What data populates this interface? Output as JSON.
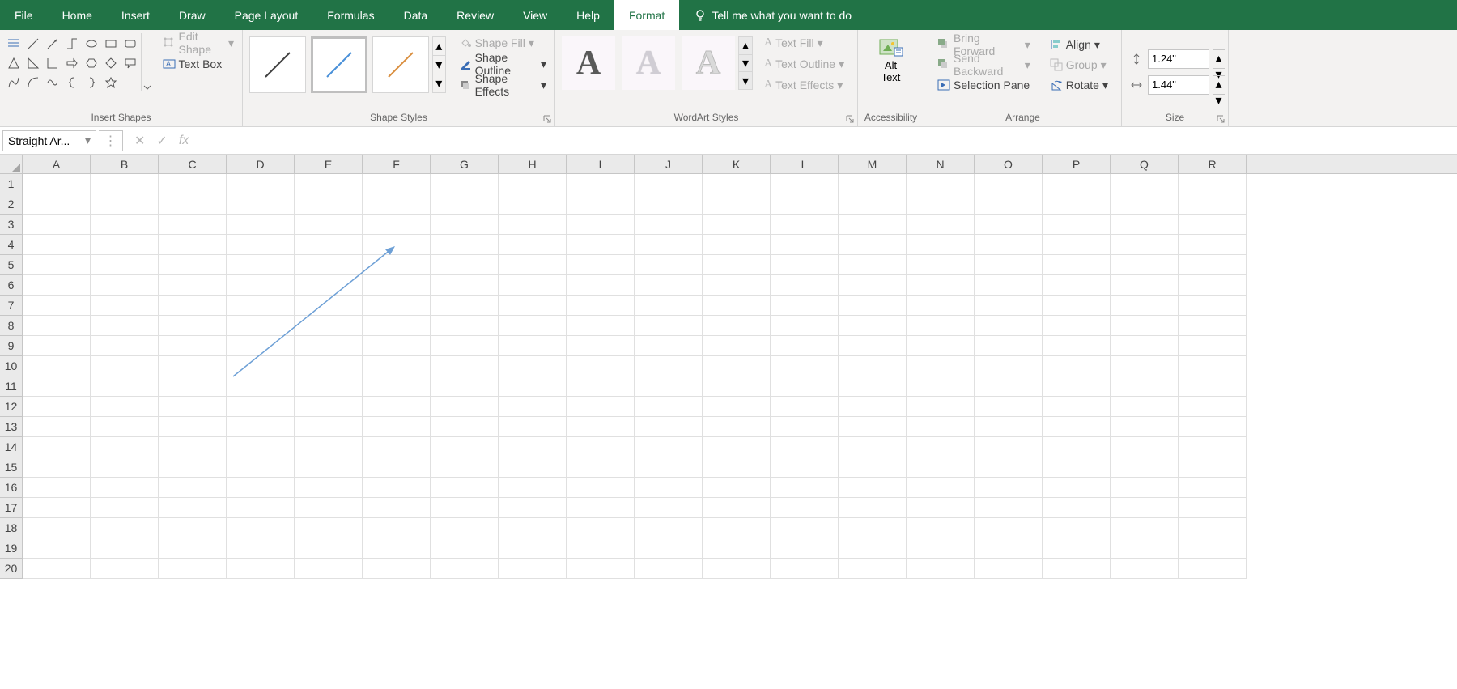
{
  "menu": [
    "File",
    "Home",
    "Insert",
    "Draw",
    "Page Layout",
    "Formulas",
    "Data",
    "Review",
    "View",
    "Help",
    "Format"
  ],
  "activeMenu": "Format",
  "tellMe": "Tell me what you want to do",
  "ribbon": {
    "insertShapes": {
      "title": "Insert Shapes",
      "editShape": "Edit Shape",
      "textBox": "Text Box"
    },
    "shapeStyles": {
      "title": "Shape Styles",
      "shapeFill": "Shape Fill",
      "shapeOutline": "Shape Outline",
      "shapeEffects": "Shape Effects"
    },
    "wordArtStyles": {
      "title": "WordArt Styles",
      "textFill": "Text Fill",
      "textOutline": "Text Outline",
      "textEffects": "Text Effects"
    },
    "accessibility": {
      "title": "Accessibility",
      "altText1": "Alt",
      "altText2": "Text"
    },
    "arrange": {
      "title": "Arrange",
      "bringForward": "Bring Forward",
      "sendBackward": "Send Backward",
      "selectionPane": "Selection Pane",
      "align": "Align",
      "group": "Group",
      "rotate": "Rotate"
    },
    "size": {
      "title": "Size",
      "height": "1.24\"",
      "width": "1.44\""
    }
  },
  "nameBox": "Straight Ar...",
  "formula": "",
  "columns": [
    "A",
    "B",
    "C",
    "D",
    "E",
    "F",
    "G",
    "H",
    "I",
    "J",
    "K",
    "L",
    "M",
    "N",
    "O",
    "P",
    "Q",
    "R"
  ],
  "rows": [
    1,
    2,
    3,
    4,
    5,
    6,
    7,
    8,
    9,
    10,
    11,
    12,
    13,
    14,
    15,
    16,
    17,
    18,
    19,
    20
  ]
}
